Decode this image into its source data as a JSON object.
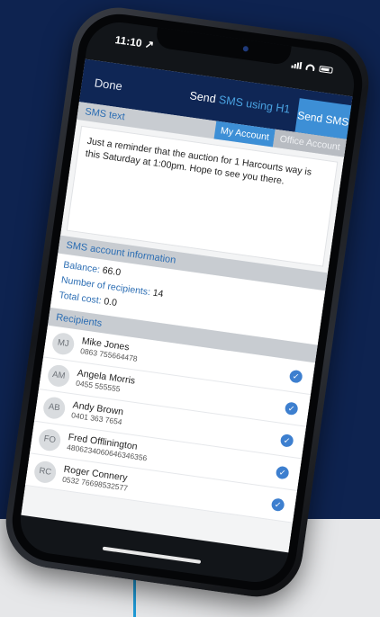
{
  "status_bar": {
    "time": "11:10 ↗"
  },
  "navbar": {
    "done_label": "Done",
    "title_prefix": "Send",
    "title_accent": "SMS using H1",
    "send_label": "Send SMS"
  },
  "sms_text": {
    "header": "SMS text",
    "tab_my_account": "My Account",
    "tab_office_account": "Office Account",
    "message": "Just a reminder that the auction for 1 Harcourts way is this Saturday at 1:00pm. Hope to see you there."
  },
  "account_info": {
    "header": "SMS account information",
    "balance_label": "Balance:",
    "balance_value": "66.0",
    "recipients_label": "Number of recipients:",
    "recipients_value": "14",
    "cost_label": "Total cost:",
    "cost_value": "0.0"
  },
  "recipients": {
    "header": "Recipients",
    "items": [
      {
        "initials": "MJ",
        "name": "Mike Jones",
        "phone": "0863 755664478",
        "checked": "✓"
      },
      {
        "initials": "AM",
        "name": "Angela Morris",
        "phone": "0455 555555",
        "checked": "✓"
      },
      {
        "initials": "AB",
        "name": "Andy Brown",
        "phone": "0401 363 7654",
        "checked": "✓"
      },
      {
        "initials": "FO",
        "name": "Fred Offlinington",
        "phone": "4806234060646346356",
        "checked": "✓"
      },
      {
        "initials": "RC",
        "name": "Roger Connery",
        "phone": "0532 76698532577",
        "checked": "✓"
      }
    ]
  },
  "colors": {
    "background": "#0e2350",
    "navbar": "#0f2655",
    "accent": "#3d8fd6",
    "checkmark": "#3d7fcf",
    "lower_band": "#e6e7e9"
  }
}
